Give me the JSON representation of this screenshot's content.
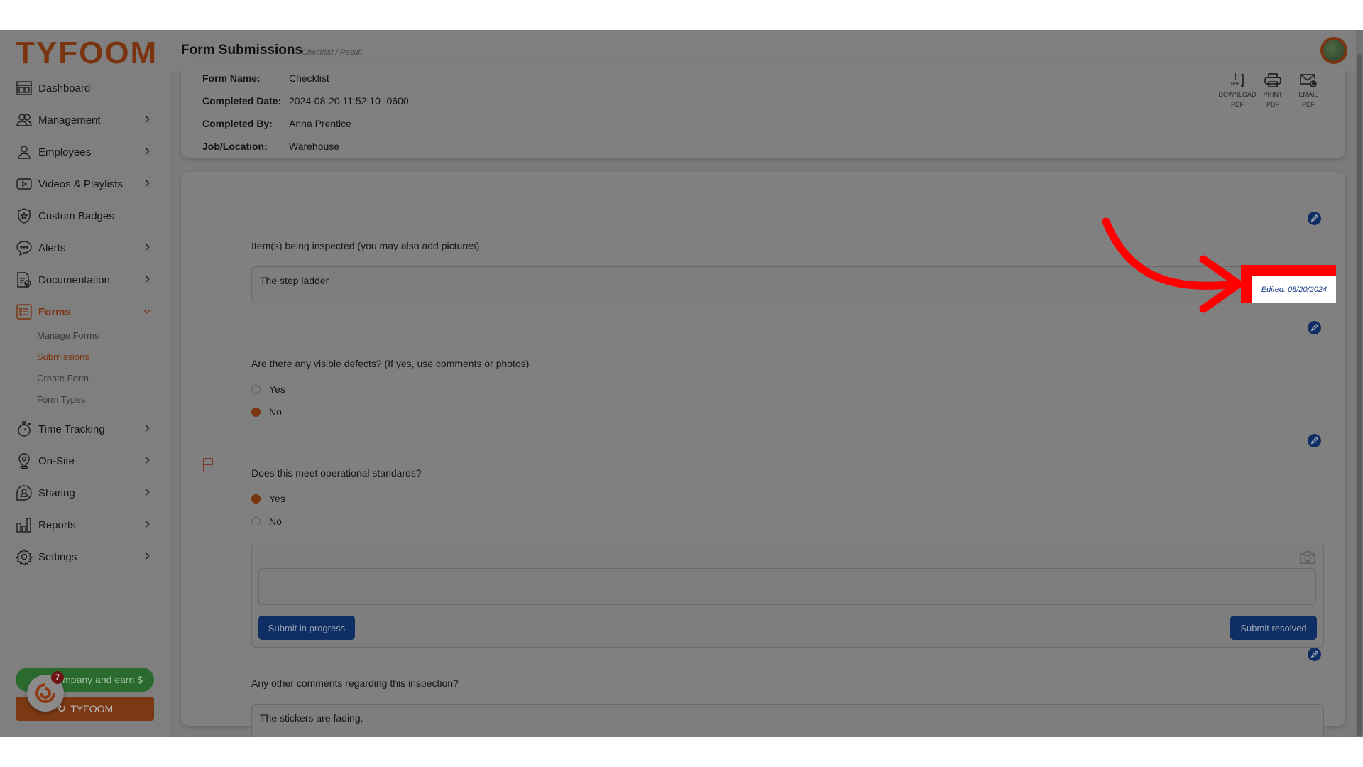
{
  "app": {
    "brand": "TYFOOM",
    "accent_color": "#c1571b",
    "primary_button_color": "#1a4a9e",
    "annotation_color": "#ff0000"
  },
  "header": {
    "title": "Form Submissions",
    "breadcrumb": "Checklist / Result",
    "avatar_icon": "user-avatar"
  },
  "sidebar": {
    "items": [
      {
        "label": "Dashboard",
        "icon": "dashboard-icon",
        "has_chevron": false
      },
      {
        "label": "Management",
        "icon": "users-icon",
        "has_chevron": true
      },
      {
        "label": "Employees",
        "icon": "user-icon",
        "has_chevron": true
      },
      {
        "label": "Videos & Playlists",
        "icon": "video-icon",
        "has_chevron": true
      },
      {
        "label": "Custom Badges",
        "icon": "badge-icon",
        "has_chevron": false
      },
      {
        "label": "Alerts",
        "icon": "chat-bubble-icon",
        "has_chevron": true
      },
      {
        "label": "Documentation",
        "icon": "document-icon",
        "has_chevron": true
      },
      {
        "label": "Forms",
        "icon": "list-icon",
        "has_chevron": true,
        "expanded": true,
        "active": true
      },
      {
        "label": "Time Tracking",
        "icon": "stopwatch-icon",
        "has_chevron": true
      },
      {
        "label": "On-Site",
        "icon": "map-pin-icon",
        "has_chevron": true
      },
      {
        "label": "Sharing",
        "icon": "share-user-icon",
        "has_chevron": true
      },
      {
        "label": "Reports",
        "icon": "bar-chart-icon",
        "has_chevron": true
      },
      {
        "label": "Settings",
        "icon": "gear-icon",
        "has_chevron": true
      }
    ],
    "forms_submenu": [
      {
        "label": "Manage Forms",
        "active": false
      },
      {
        "label": "Submissions",
        "active": true
      },
      {
        "label": "Create Form",
        "active": false
      },
      {
        "label": "Form Types",
        "active": false
      }
    ],
    "refer_button": "Refer a company and earn $",
    "refer_button_visible": "ompany and earn $",
    "tyfoom_button": "TYFOOM",
    "chat_badge_count": "7"
  },
  "submission": {
    "fields": [
      {
        "label": "Form Name:",
        "value": "Checklist"
      },
      {
        "label": "Completed Date:",
        "value": "2024-08-20 11:52:10 -0600"
      },
      {
        "label": "Completed By:",
        "value": "Anna Prentice"
      },
      {
        "label": "Job/Location:",
        "value": "Warehouse"
      }
    ],
    "actions": [
      {
        "label_line1": "DOWNLOAD",
        "label_line2": "PDF",
        "icon": "download-pdf-icon"
      },
      {
        "label_line1": "PRINT",
        "label_line2": "PDF",
        "icon": "printer-icon"
      },
      {
        "label_line1": "EMAIL",
        "label_line2": "PDF",
        "icon": "email-icon"
      }
    ]
  },
  "questions": [
    {
      "label": "Item(s) being inspected (you may also add pictures)",
      "type": "text",
      "value": "The step ladder",
      "edited": "Edited: 08/20/2024"
    },
    {
      "label": "Are there any visible defects? (If yes, use comments or photos)",
      "type": "radio",
      "options": [
        "Yes",
        "No"
      ],
      "selected": "No"
    },
    {
      "label": "Does this meet operational standards?",
      "type": "radio",
      "options": [
        "Yes",
        "No"
      ],
      "selected": "Yes",
      "flagged": true,
      "comment_value": "",
      "buttons": {
        "in_progress": "Submit in progress",
        "resolved": "Submit resolved"
      }
    },
    {
      "label": "Any other comments regarding this inspection?",
      "type": "text",
      "value": "The stickers are fading."
    }
  ]
}
